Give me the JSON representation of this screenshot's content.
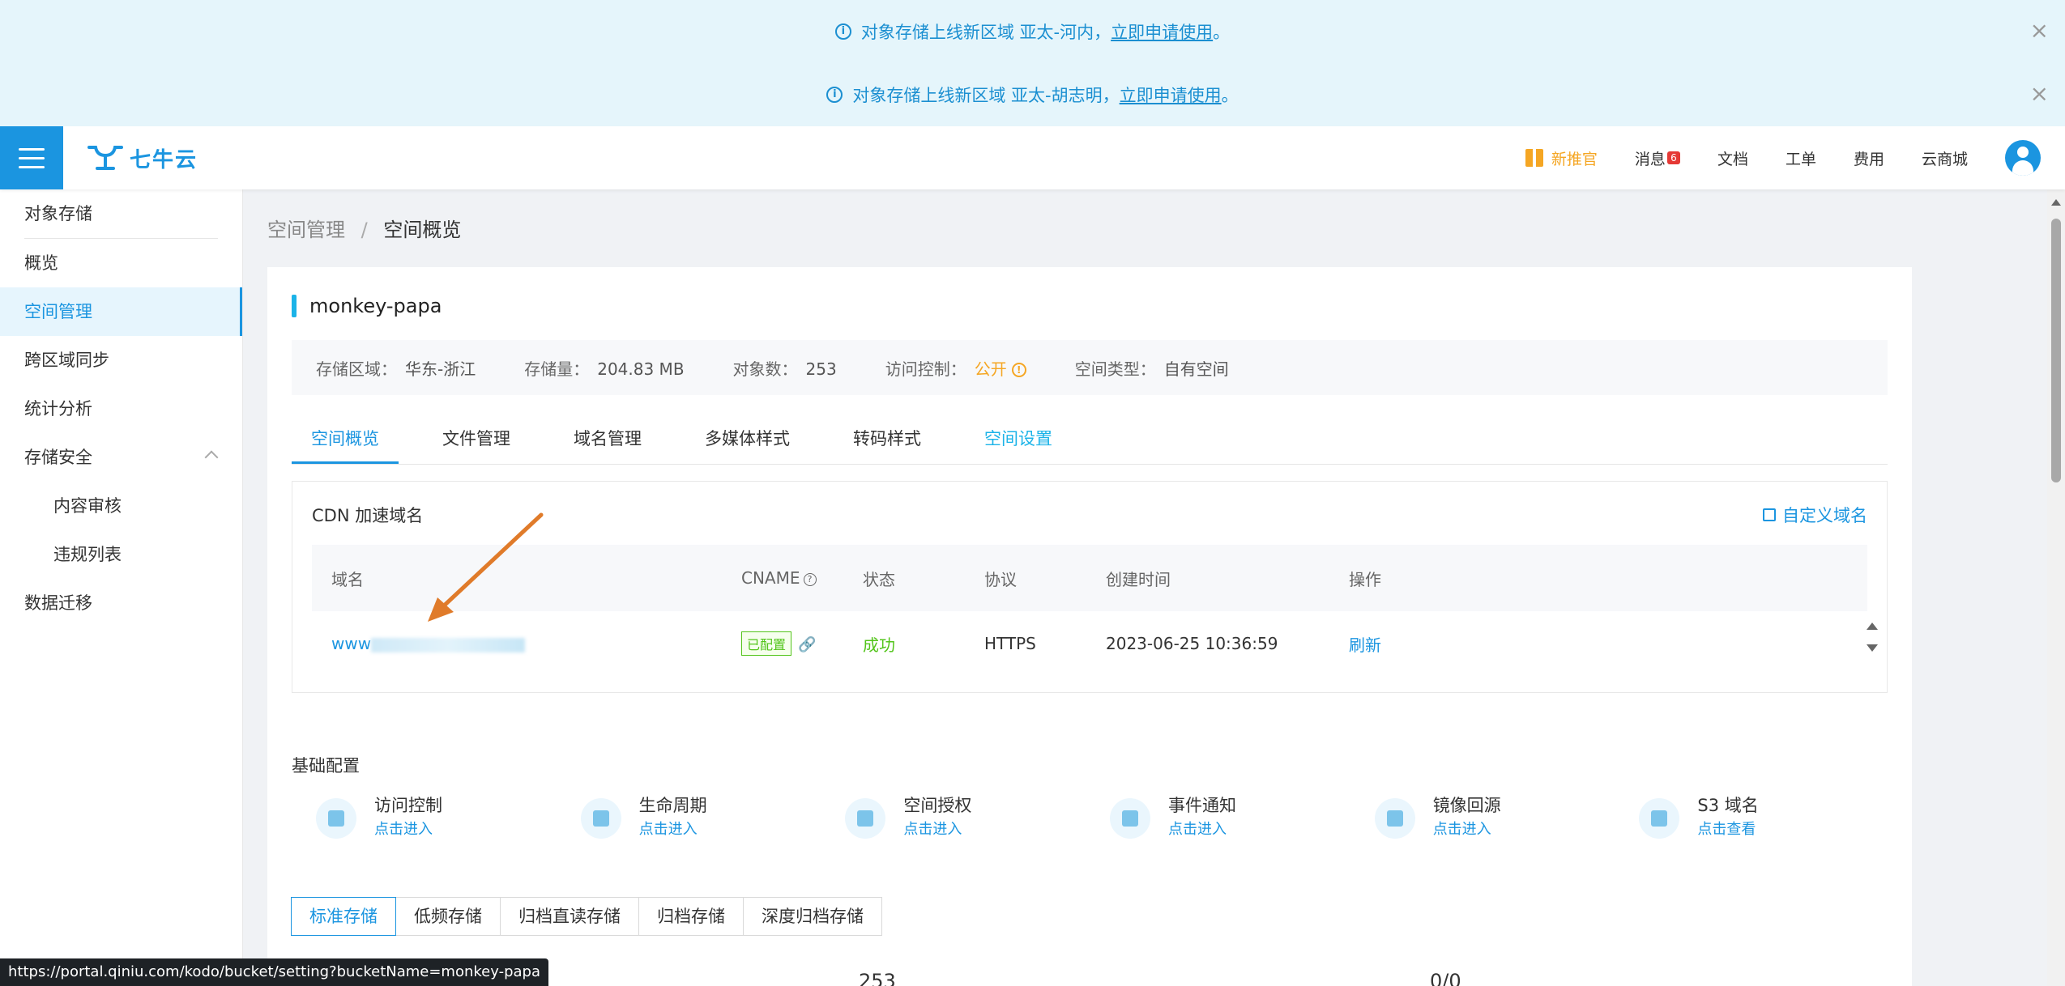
{
  "notices": [
    {
      "text": "对象存储上线新区域 亚太-河内，",
      "link": "立即申请使用",
      "end": "。"
    },
    {
      "text": "对象存储上线新区域 亚太-胡志明，",
      "link": "立即申请使用",
      "end": "。"
    }
  ],
  "header": {
    "logo_text": "七牛云",
    "promo": "新推官",
    "messages": "消息",
    "messages_count": "6",
    "docs": "文档",
    "tickets": "工单",
    "billing": "费用",
    "market": "云商城"
  },
  "sidebar": {
    "items": [
      {
        "label": "对象存储"
      },
      {
        "label": "概览"
      },
      {
        "label": "空间管理"
      },
      {
        "label": "跨区域同步"
      },
      {
        "label": "统计分析"
      },
      {
        "label": "存储安全"
      },
      {
        "label": "内容审核"
      },
      {
        "label": "违规列表"
      },
      {
        "label": "数据迁移"
      }
    ]
  },
  "breadcrumb": {
    "parent": "空间管理",
    "sep": "/",
    "current": "空间概览"
  },
  "bucket": {
    "name": "monkey-papa",
    "region_label": "存储区域：",
    "region": "华东-浙江",
    "size_label": "存储量：",
    "size": "204.83 MB",
    "objects_label": "对象数：",
    "objects": "253",
    "access_label": "访问控制：",
    "access": "公开",
    "type_label": "空间类型：",
    "type": "自有空间"
  },
  "tabs": [
    "空间概览",
    "文件管理",
    "域名管理",
    "多媒体样式",
    "转码样式",
    "空间设置"
  ],
  "cdn": {
    "title": "CDN 加速域名",
    "custom_link": "自定义域名",
    "columns": [
      "域名",
      "CNAME",
      "状态",
      "协议",
      "创建时间",
      "操作"
    ],
    "row": {
      "domain_prefix": "www",
      "cname": "已配置",
      "status": "成功",
      "protocol": "HTTPS",
      "created": "2023-06-25 10:36:59",
      "action": "刷新"
    }
  },
  "basic": {
    "title": "基础配置",
    "items": [
      {
        "name": "访问控制",
        "link": "点击进入",
        "icon": "user-lock-icon"
      },
      {
        "name": "生命周期",
        "link": "点击进入",
        "icon": "lifecycle-icon"
      },
      {
        "name": "空间授权",
        "link": "点击进入",
        "icon": "box-auth-icon"
      },
      {
        "name": "事件通知",
        "link": "点击进入",
        "icon": "clipboard-clock-icon"
      },
      {
        "name": "镜像回源",
        "link": "点击进入",
        "icon": "mirror-icon"
      },
      {
        "name": "S3 域名",
        "link": "点击查看",
        "icon": "globe-icon"
      }
    ]
  },
  "storage_types": [
    "标准存储",
    "低频存储",
    "归档直读存储",
    "归档存储",
    "深度归档存储"
  ],
  "partial_values": [
    "253",
    "0/0"
  ],
  "status_url": "https://portal.qiniu.com/kodo/bucket/setting?bucketName=monkey-papa",
  "colors": {
    "primary": "#1b95e0",
    "notice_bg": "#e5f5fb",
    "warning": "#f5a623",
    "success": "#52c41a",
    "annotation_arrow": "#e07b2a"
  }
}
